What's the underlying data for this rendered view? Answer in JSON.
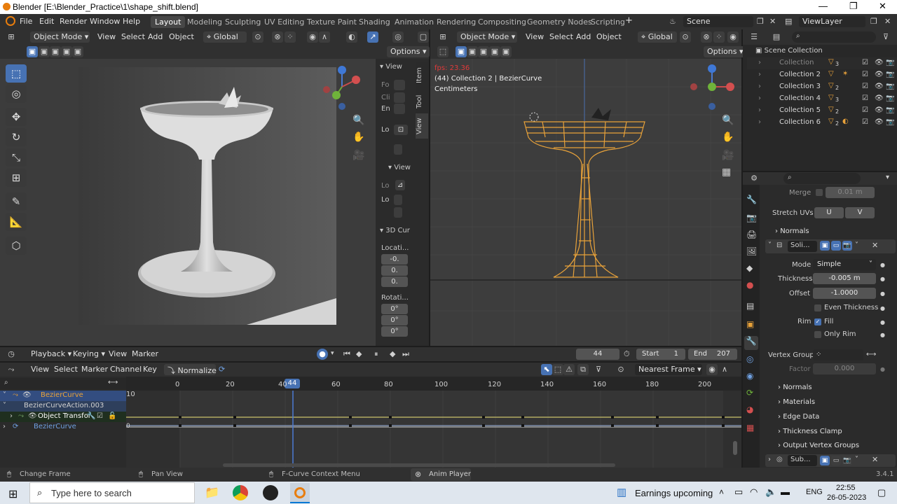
{
  "window": {
    "title": "Blender [E:\\Blender_Practice\\1\\shape_shift.blend]",
    "minimize": "—",
    "maximize": "❐",
    "close": "✕"
  },
  "topbar": {
    "menus": [
      "File",
      "Edit",
      "Render",
      "Window",
      "Help"
    ],
    "workspaces": [
      "Layout",
      "Modeling",
      "Sculpting",
      "UV Editing",
      "Texture Paint",
      "Shading",
      "Animation",
      "Rendering",
      "Compositing",
      "Geometry Nodes",
      "Scripting"
    ],
    "active_workspace": "Layout",
    "add_tab": "+",
    "scene": "Scene",
    "view_layer": "ViewLayer"
  },
  "viewport_left": {
    "mode": "Object Mode",
    "menus": [
      "View",
      "Select",
      "Add",
      "Object"
    ],
    "orientation": "Global",
    "options": "Options"
  },
  "npanel": {
    "view_header": "View",
    "focal_lbl": "Fo",
    "clip_lbl": "Cli",
    "end_lbl": "En",
    "local_lbl": "Lo",
    "view2_header": "View",
    "lock_lbl": "Lo",
    "lock2_lbl": "Lo",
    "cursor_header": "3D Cur",
    "location_lbl": "Locati...",
    "loc_values": [
      "-0.",
      "0.",
      "0."
    ],
    "rotation_lbl": "Rotati...",
    "rot_values": [
      "0°",
      "0°",
      "0°"
    ],
    "tabs": [
      "Item",
      "Tool",
      "View"
    ]
  },
  "viewport_right": {
    "mode": "Object Mode",
    "menus": [
      "View",
      "Select",
      "Add",
      "Object"
    ],
    "orientation": "Global",
    "options": "Options",
    "fps": "fps: 23.36",
    "info": "(44) Collection 2 | BezierCurve",
    "units": "Centimeters"
  },
  "outliner": {
    "root": "Scene Collection",
    "items": [
      {
        "name": "Collection",
        "count": "3"
      },
      {
        "name": "Collection 2",
        "count": ""
      },
      {
        "name": "Collection 3",
        "count": "2"
      },
      {
        "name": "Collection 4",
        "count": "3"
      },
      {
        "name": "Collection 5",
        "count": "2"
      },
      {
        "name": "Collection 6",
        "count": "2"
      }
    ]
  },
  "properties": {
    "merge_lbl": "Merge",
    "merge_val": "0.01 m",
    "stretch_lbl": "Stretch UVs",
    "stretch_u": "U",
    "stretch_v": "V",
    "normals_top": "Normals",
    "solidify_name": "Soli...",
    "mode_lbl": "Mode",
    "mode_val": "Simple",
    "thickness_lbl": "Thickness",
    "thickness_val": "-0.005 m",
    "offset_lbl": "Offset",
    "offset_val": "-1.0000",
    "even_lbl": "Even Thickness",
    "rim_lbl": "Rim",
    "fill_lbl": "Fill",
    "only_rim_lbl": "Only Rim",
    "vgroup_lbl": "Vertex Group",
    "factor_lbl": "Factor",
    "factor_val": "0.000",
    "sections": [
      "Normals",
      "Materials",
      "Edge Data",
      "Thickness Clamp",
      "Output Vertex Groups"
    ],
    "subsurf_name": "Sub..."
  },
  "timeline": {
    "menus": [
      "Playback",
      "Keying",
      "View",
      "Marker"
    ],
    "current_frame": "44",
    "start_lbl": "Start",
    "start_val": "1",
    "end_lbl": "End",
    "end_val": "207"
  },
  "graph_editor": {
    "menus": [
      "View",
      "Select",
      "Marker",
      "Channel",
      "Key"
    ],
    "normalize": "Normalize",
    "snap": "Nearest Frame",
    "ticks": [
      "0",
      "20",
      "40",
      "60",
      "80",
      "100",
      "120",
      "140",
      "160",
      "180",
      "200"
    ],
    "playhead": "44",
    "y_label": "10",
    "y_zero": "0",
    "channels": [
      "BezierCurve",
      "BezierCurveAction.003",
      "Object Transfor",
      "BezierCurve"
    ]
  },
  "statusbar": {
    "left": "Change Frame",
    "mid": "Pan View",
    "right": "F-Curve Context Menu",
    "anim": "Anim Player",
    "version": "3.4.1"
  },
  "taskbar": {
    "search_placeholder": "Type here to search",
    "news": "Earnings upcoming",
    "lang": "ENG",
    "time": "22:55",
    "date": "26-05-2023"
  },
  "colors": {
    "accent": "#4772b3",
    "selected_orange": "#e8a23a",
    "blender_orange": "#e87d0d"
  }
}
